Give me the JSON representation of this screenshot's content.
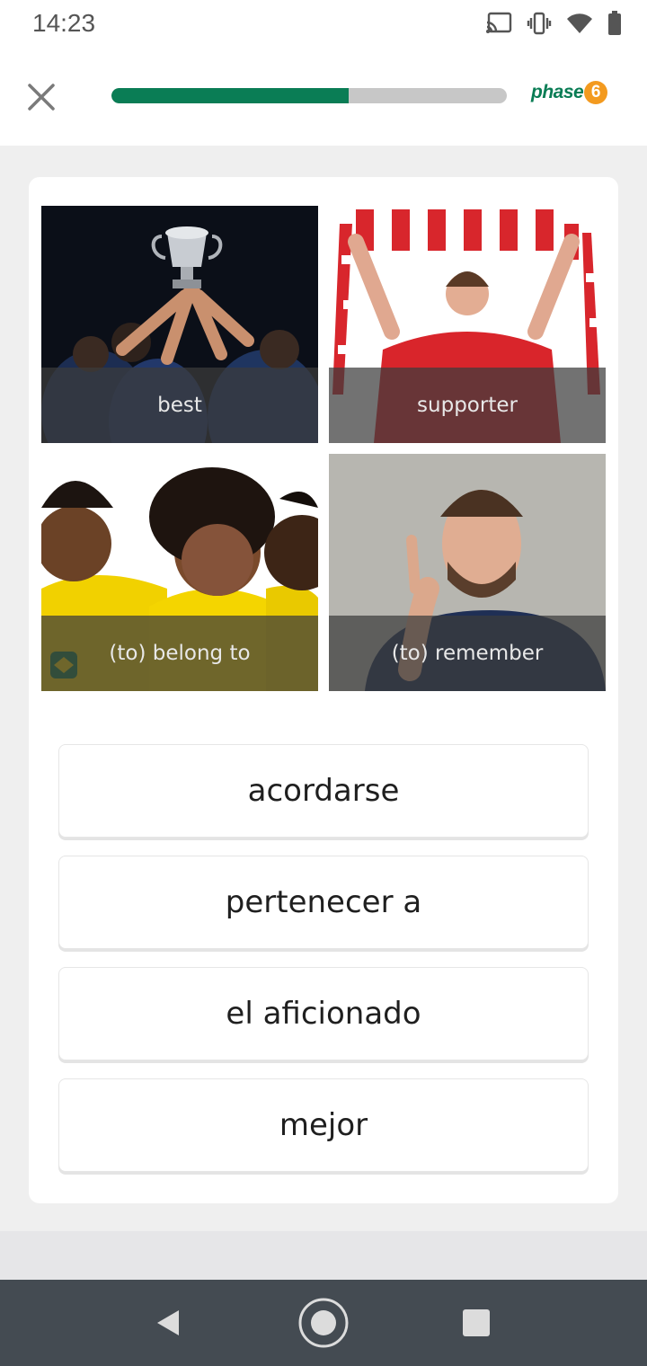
{
  "status_bar": {
    "time": "14:23",
    "icons": [
      "cast-icon",
      "vibrate-icon",
      "wifi-icon",
      "battery-icon"
    ]
  },
  "header": {
    "close_icon": "close-icon",
    "progress_fraction": 0.6,
    "brand_text": "phase",
    "brand_number": "6",
    "colors": {
      "progress": "#0a7d55",
      "track": "#c7c7c7",
      "brand_green": "#0a7d55",
      "brand_orange": "#f39a1f"
    }
  },
  "images": [
    {
      "label": "best",
      "depicts": "team holding trophy"
    },
    {
      "label": "supporter",
      "depicts": "fan holding scarf"
    },
    {
      "label": "(to) belong to",
      "depicts": "laughing friends"
    },
    {
      "label": "(to) remember",
      "depicts": "man thinking"
    }
  ],
  "answers": [
    {
      "label": "acordarse"
    },
    {
      "label": "pertenecer a"
    },
    {
      "label": "el aficionado"
    },
    {
      "label": "mejor"
    }
  ],
  "nav_bar": {
    "buttons": [
      "back-icon",
      "home-icon",
      "recents-icon"
    ]
  }
}
